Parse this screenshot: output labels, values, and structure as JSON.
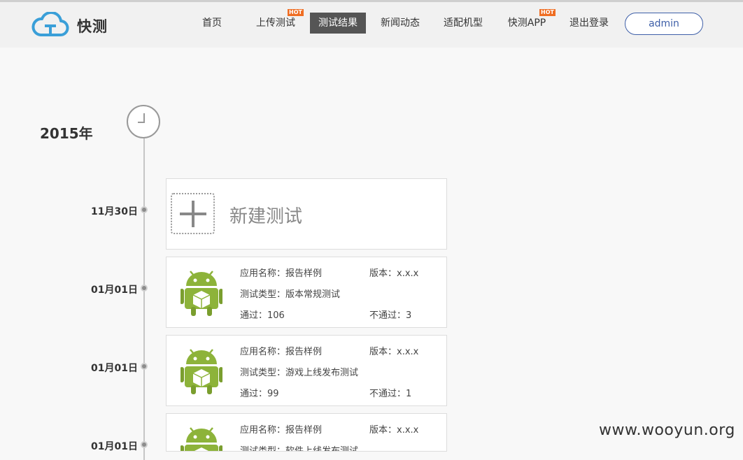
{
  "app": {
    "logo_text": "快测"
  },
  "nav": {
    "items": [
      {
        "label": "首页"
      },
      {
        "label": "上传测试",
        "badge": "HOT"
      },
      {
        "label": "测试结果"
      },
      {
        "label": "新闻动态"
      },
      {
        "label": "适配机型"
      },
      {
        "label": "快测APP",
        "badge": "HOT"
      },
      {
        "label": "退出登录"
      }
    ],
    "user": "admin"
  },
  "timeline": {
    "year": "2015年",
    "new_test": {
      "date": "11月30日",
      "label": "新建测试"
    },
    "entries": [
      {
        "date": "01月01日",
        "app_name": "应用名称：报告样例",
        "version": "版本：x.x.x",
        "test_type": "测试类型：版本常规测试",
        "pass": "通过：106",
        "fail": "不通过：3"
      },
      {
        "date": "01月01日",
        "app_name": "应用名称：报告样例",
        "version": "版本：x.x.x",
        "test_type": "测试类型：游戏上线发布测试",
        "pass": "通过：99",
        "fail": "不通过：1"
      },
      {
        "date": "01月01日",
        "app_name": "应用名称：报告样例",
        "version": "版本：x.x.x",
        "test_type": "测试类型：软件上线发布测试",
        "pass": "",
        "fail": ""
      }
    ]
  },
  "watermark": "www.wooyun.org",
  "colors": {
    "accent": "#3e5fa8",
    "hot_badge": "#ef6d22",
    "active_nav": "#555555",
    "android_green": "#8db33a"
  }
}
